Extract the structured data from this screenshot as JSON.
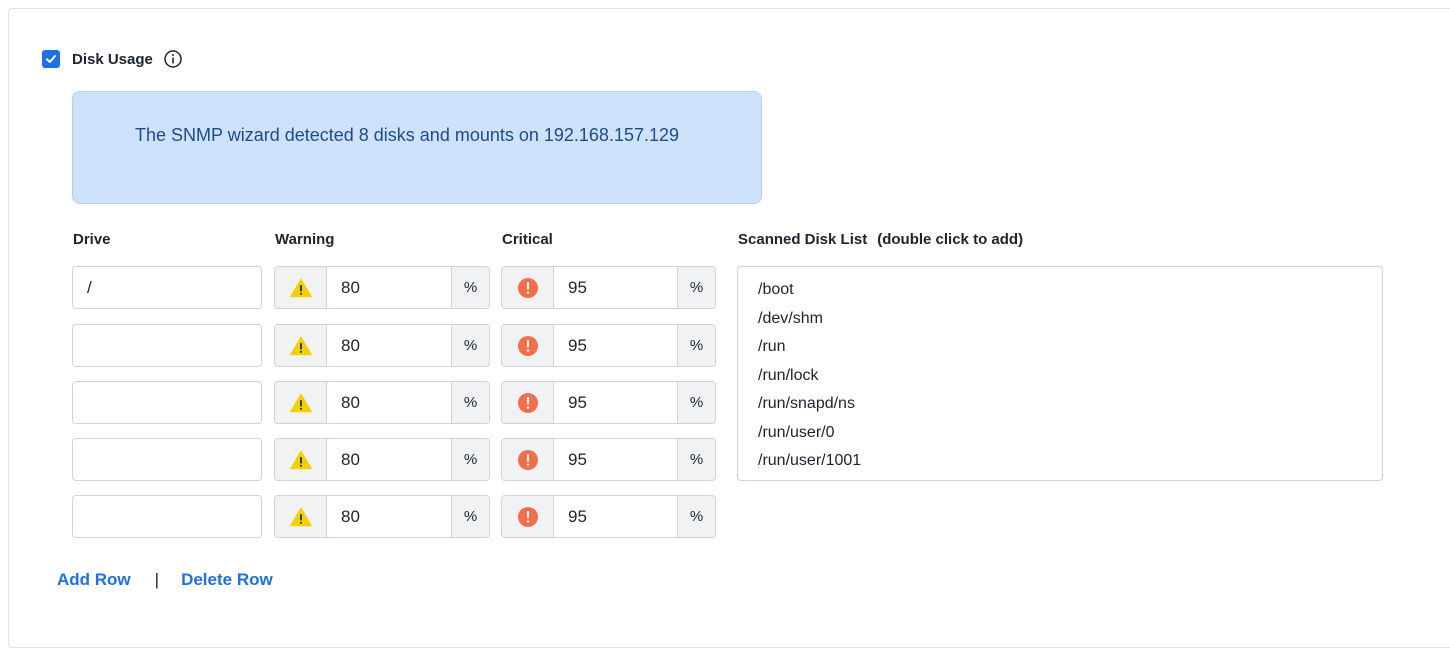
{
  "section": {
    "title": "Disk Usage",
    "enabled": true
  },
  "alert": {
    "text": "The SNMP wizard detected 8 disks and mounts on 192.168.157.129"
  },
  "columns": {
    "drive": "Drive",
    "warning": "Warning",
    "critical": "Critical",
    "scanned": "Scanned Disk List",
    "scanned_hint": "(double click to add)"
  },
  "rows": [
    {
      "drive": "/",
      "warning": "80",
      "critical": "95"
    },
    {
      "drive": "",
      "warning": "80",
      "critical": "95"
    },
    {
      "drive": "",
      "warning": "80",
      "critical": "95"
    },
    {
      "drive": "",
      "warning": "80",
      "critical": "95"
    },
    {
      "drive": "",
      "warning": "80",
      "critical": "95"
    }
  ],
  "unit": "%",
  "scanned_disks": [
    "/boot",
    "/dev/shm",
    "/run",
    "/run/lock",
    "/run/snapd/ns",
    "/run/user/0",
    "/run/user/1001"
  ],
  "actions": {
    "add_row": "Add Row",
    "separator": "|",
    "delete_row": "Delete Row"
  },
  "colors": {
    "accent": "#1f6fe5",
    "alert_bg": "#cfe2fc",
    "alert_text": "#1f4a8f",
    "warning_icon": "#f5d000",
    "critical_icon": "#f26f4e"
  }
}
